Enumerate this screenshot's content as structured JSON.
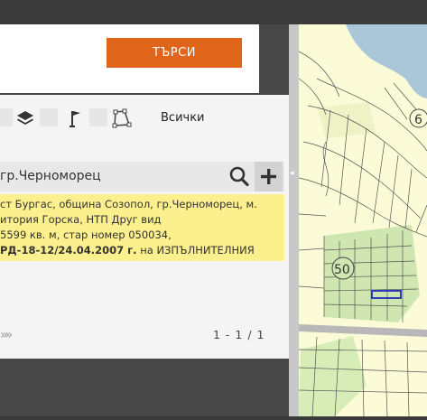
{
  "search": {
    "button_label": "ТЪРСИ"
  },
  "filters": {
    "icons": [
      "square-icon",
      "layers-icon",
      "square-icon",
      "flag-icon",
      "square-icon",
      "polygon-icon"
    ],
    "all_label": "Всички"
  },
  "query": {
    "value": "гр.Черноморец"
  },
  "result": {
    "line1": "ст Бургас, община Созопол, гр.Черноморец, м.",
    "line2": "итория Горска, НТП Друг вид",
    "line3": "5599 кв. м, стар номер 050034,",
    "line4_bold": "РД-18-12/24.04.2007 г.",
    "line4_rest": " на ИЗПЪЛНИТЕЛНИЯ"
  },
  "pager": {
    "count": "1 - 1 / 1"
  },
  "map": {
    "labels": [
      "6",
      "50"
    ],
    "colors": {
      "sea": "#a9c7d8",
      "land": "#fbfbd7",
      "parcel_green": "#cfe6b0",
      "highlight": "#2d3fb8",
      "road": "#b8b8b8"
    }
  }
}
